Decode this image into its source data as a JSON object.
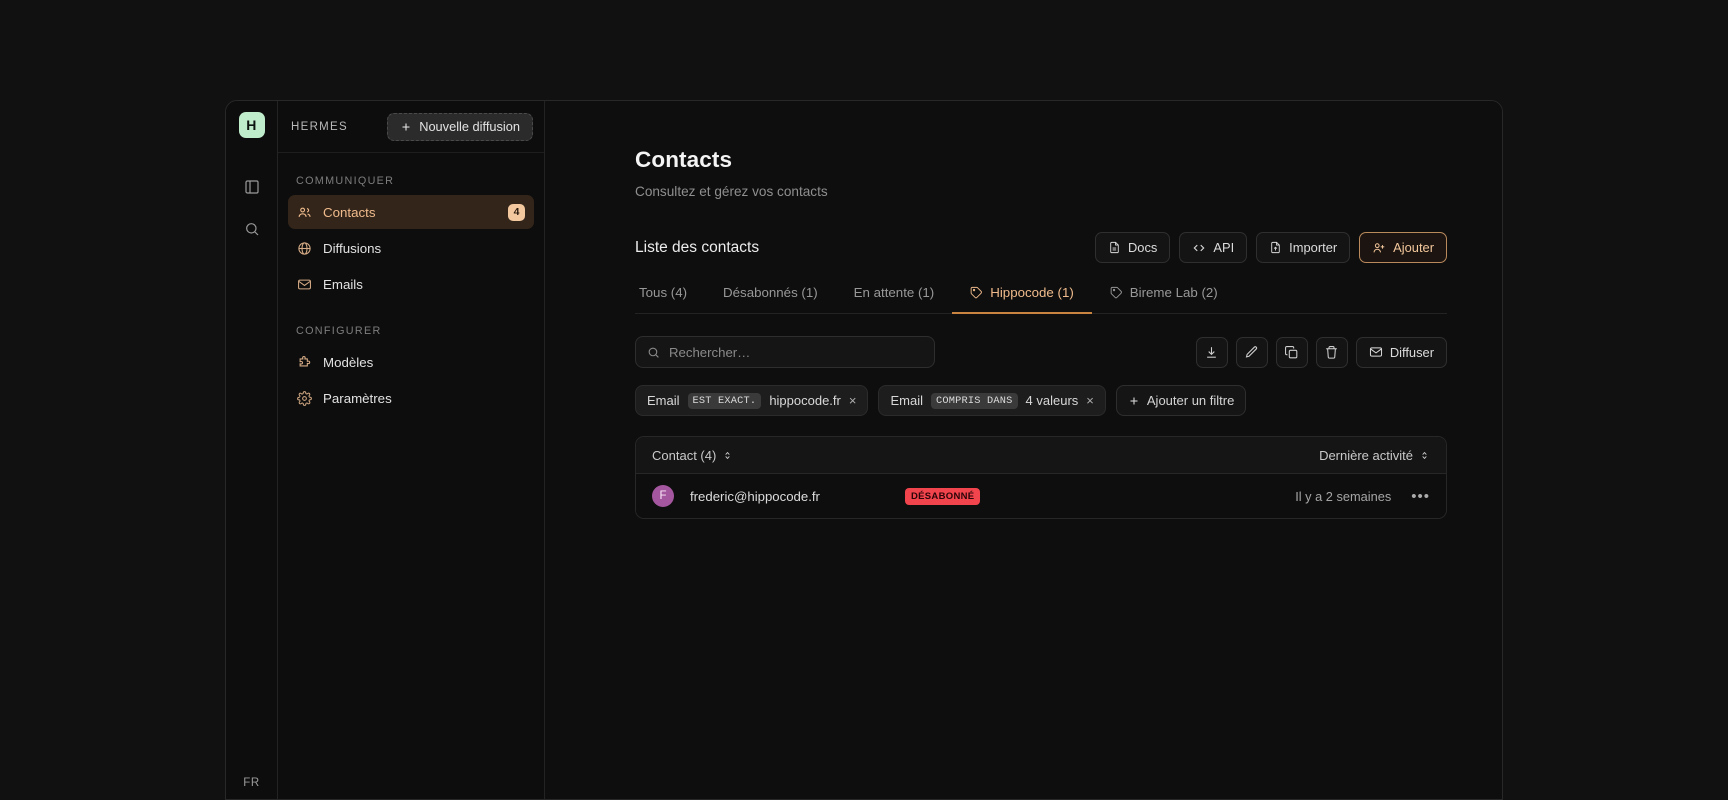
{
  "rail": {
    "logo_letter": "H",
    "panel_icon": "panel-left-icon",
    "search_icon": "search-icon",
    "language": "FR"
  },
  "sidebar": {
    "brand": "HERMES",
    "new_broadcast_label": "Nouvelle diffusion",
    "sections": [
      {
        "heading": "COMMUNIQUER",
        "items": [
          {
            "label": "Contacts",
            "icon": "users-icon",
            "badge": "4",
            "active": true
          },
          {
            "label": "Diffusions",
            "icon": "globe-icon",
            "badge": "",
            "active": false
          },
          {
            "label": "Emails",
            "icon": "mail-icon",
            "badge": "",
            "active": false
          }
        ]
      },
      {
        "heading": "CONFIGURER",
        "items": [
          {
            "label": "Modèles",
            "icon": "puzzle-icon",
            "badge": "",
            "active": false
          },
          {
            "label": "Paramètres",
            "icon": "gear-icon",
            "badge": "",
            "active": false
          }
        ]
      }
    ]
  },
  "page": {
    "title": "Contacts",
    "subtitle": "Consultez et gérez vos contacts",
    "section_title": "Liste des contacts"
  },
  "header_buttons": [
    {
      "label": "Docs",
      "icon": "file-text-icon",
      "accent": false
    },
    {
      "label": "API",
      "icon": "code-icon",
      "accent": false
    },
    {
      "label": "Importer",
      "icon": "file-import-icon",
      "accent": false
    },
    {
      "label": "Ajouter",
      "icon": "user-plus-icon",
      "accent": true
    }
  ],
  "tabs": [
    {
      "label": "Tous (4)",
      "icon": "",
      "active": false
    },
    {
      "label": "Désabonnés (1)",
      "icon": "",
      "active": false
    },
    {
      "label": "En attente (1)",
      "icon": "",
      "active": false
    },
    {
      "label": "Hippocode (1)",
      "icon": "tag-icon",
      "active": true
    },
    {
      "label": "Bireme Lab (2)",
      "icon": "tag-icon",
      "active": false
    }
  ],
  "search": {
    "placeholder": "Rechercher…",
    "value": "",
    "icon": "search-icon"
  },
  "actions": [
    {
      "name": "download-button",
      "icon": "download-icon"
    },
    {
      "name": "edit-button",
      "icon": "pencil-icon"
    },
    {
      "name": "duplicate-button",
      "icon": "copy-icon"
    },
    {
      "name": "delete-button",
      "icon": "trash-icon"
    }
  ],
  "broadcast_button": {
    "label": "Diffuser",
    "icon": "mail-icon"
  },
  "filters": {
    "chips": [
      {
        "field": "Email",
        "operator": "EST EXACT.",
        "value": "hippocode.fr",
        "remove": "×"
      },
      {
        "field": "Email",
        "operator": "COMPRIS DANS",
        "value": "4 valeurs",
        "remove": "×"
      }
    ],
    "add_label": "Ajouter un filtre",
    "add_icon": "plus-icon"
  },
  "table": {
    "columns": [
      {
        "label": "Contact (4)",
        "sort_icon": "sort-icon",
        "align": "left"
      },
      {
        "label": "Dernière activité",
        "sort_icon": "sort-icon",
        "align": "right"
      }
    ],
    "rows": [
      {
        "avatar_letter": "F",
        "avatar_color": "#a4579e",
        "email": "frederic@hippocode.fr",
        "status": "DÉSABONNÉ",
        "status_color": "#f1444d",
        "last_activity": "Il y a 2 semaines",
        "menu": "•••"
      }
    ]
  },
  "colors": {
    "accent": "#f0bb8c",
    "accent_underline": "#c98442",
    "logo_bg": "#bfeccb",
    "badge_bg": "#f4c89f",
    "unsubscribed": "#f1444d",
    "avatar": "#a4579e",
    "app_bg": "#0e0e0e",
    "page_bg": "#111111"
  }
}
